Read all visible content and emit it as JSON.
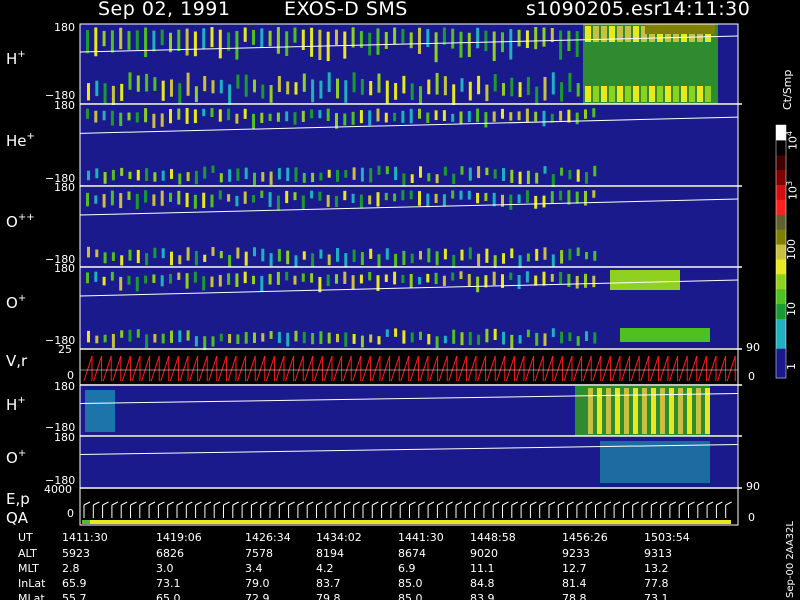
{
  "header": {
    "date": "Sep 02, 1991",
    "instrument": "EXOS-D SMS",
    "file": "s1090205.esr",
    "time": "14:11:30"
  },
  "panels": {
    "h_plus": {
      "label_main": "H",
      "label_sup": "+",
      "ymax": "180",
      "ymin": "−180"
    },
    "he_plus": {
      "label_main": "He",
      "label_sup": "+",
      "ymax": "180",
      "ymin": "−180"
    },
    "o_pp": {
      "label_main": "O",
      "label_sup": "++",
      "ymax": "180",
      "ymin": "−180"
    },
    "o_plus": {
      "label_main": "O",
      "label_sup": "+",
      "ymax": "180",
      "ymin": "−180"
    },
    "vr": {
      "label": "V,r",
      "ytop": "25",
      "ymid": "0",
      "right_top": "90",
      "right_bottom": "0"
    },
    "h_plus_2": {
      "label_main": "H",
      "label_sup": "+",
      "ymax": "180",
      "ymin": "−180"
    },
    "o_plus_2": {
      "label_main": "O",
      "label_sup": "+",
      "ymax": "180",
      "ymin": "−180",
      "right": "90"
    },
    "ep": {
      "label_top": "E,p",
      "label_bottom": "QA",
      "ytop": "4000",
      "ymid": "0",
      "right": "0"
    }
  },
  "colorbar": {
    "unit": "Ct/Smp",
    "ticks": {
      "t4_base": "10",
      "t4_exp": "4",
      "t3_base": "10",
      "t3_exp": "3",
      "t100": "100",
      "t10": "10",
      "t1": "1"
    },
    "colors": [
      "#1a1a8c",
      "#1a1a8c",
      "#20b0c0",
      "#20b0c0",
      "#1a9a30",
      "#50c020",
      "#90d020",
      "#e8e820",
      "#c8c040",
      "#808000",
      "#606030",
      "#ff2020",
      "#d01010",
      "#800000",
      "#400000",
      "#000000",
      "#ffffff"
    ]
  },
  "ephemeris": {
    "labels": [
      "UT",
      "ALT",
      "MLT",
      "InLat",
      "MLat"
    ],
    "columns": [
      {
        "UT": "1411:30",
        "ALT": "5923",
        "MLT": "2.8",
        "InLat": "65.9",
        "MLat": "55.7"
      },
      {
        "UT": "1419:06",
        "ALT": "6826",
        "MLT": "3.0",
        "InLat": "73.1",
        "MLat": "65.0"
      },
      {
        "UT": "1426:34",
        "ALT": "7578",
        "MLT": "3.4",
        "InLat": "79.0",
        "MLat": "72.9"
      },
      {
        "UT": "1434:02",
        "ALT": "8194",
        "MLT": "4.2",
        "InLat": "83.7",
        "MLat": "79.8"
      },
      {
        "UT": "1441:30",
        "ALT": "8674",
        "MLT": "6.9",
        "InLat": "85.0",
        "MLat": "85.0"
      },
      {
        "UT": "1448:58",
        "ALT": "9020",
        "MLT": "11.1",
        "InLat": "84.8",
        "MLat": "83.9"
      },
      {
        "UT": "1456:26",
        "ALT": "9233",
        "MLT": "12.7",
        "InLat": "81.4",
        "MLat": "78.8"
      },
      {
        "UT": "1503:54",
        "ALT": "9313",
        "MLT": "13.2",
        "InLat": "77.8",
        "MLat": "73.1"
      }
    ]
  },
  "footer": {
    "stamp": "Sep-00 2AA32L"
  },
  "chart_data": {
    "type": "heatmap",
    "title": "Sep 02, 1991   EXOS-D SMS",
    "x_ticks": [
      "1411:30",
      "1419:06",
      "1426:34",
      "1434:02",
      "1441:30",
      "1448:58",
      "1456:26",
      "1503:54"
    ],
    "panels": [
      "H+",
      "He+",
      "O++",
      "O+",
      "V,r",
      "H+",
      "O+",
      "E,p"
    ],
    "ylim_pitch": [
      -180,
      180
    ],
    "color_scale": "log",
    "colorbar_range": [
      1,
      10000
    ],
    "colorbar_label": "Ct/Smp"
  }
}
